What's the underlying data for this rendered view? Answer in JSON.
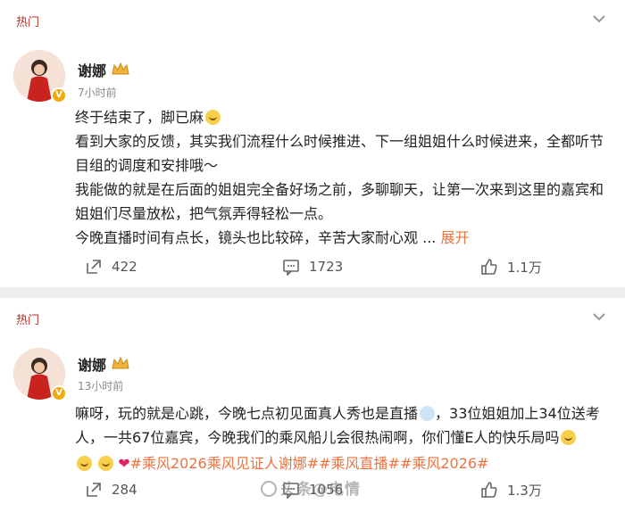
{
  "posts": [
    {
      "hot_label": "热门",
      "author": "谢娜",
      "time": "7小时前",
      "lines": [
        "终于结束了，脚已麻",
        "看到大家的反馈，其实我们流程什么时候推进、下一组姐姐什么时候进来，全都听节目组的调度和安排哦～",
        "我能做的就是在后面的姐姐完全备好场之前，多聊聊天，让第一次来到这里的嘉宾和姐姐们尽量放松，把气氛弄得轻松一点。",
        "今晚直播时间有点长，镜头也比较碎，辛苦大家耐心观"
      ],
      "ellipsis": "...",
      "expand": "展开",
      "reposts": "422",
      "comments": "1723",
      "likes": "1.1万"
    },
    {
      "hot_label": "热门",
      "author": "谢娜",
      "time": "13小时前",
      "text": "嘛呀，玩的就是心跳，今晚七点初见面真人秀也是直播",
      "text2": "，33位姐姐加上34位送考人，一共67位嘉宾，今晚我们的乘风船儿会很热闹啊，你们懂E人的快乐局吗",
      "tags": "#乘风2026乘风见证人谢娜##乘风直播##乘风2026#",
      "reposts": "284",
      "comments": "1056",
      "likes": "1.3万"
    }
  ],
  "watermark": "头条@电情",
  "colors": {
    "accent": "#eb7340",
    "hot": "#b2322c",
    "heart": "#e0245e"
  },
  "icons": [
    "chevron-down-icon",
    "crown-icon",
    "verified-badge-icon",
    "repost-icon",
    "comment-icon",
    "like-icon"
  ]
}
